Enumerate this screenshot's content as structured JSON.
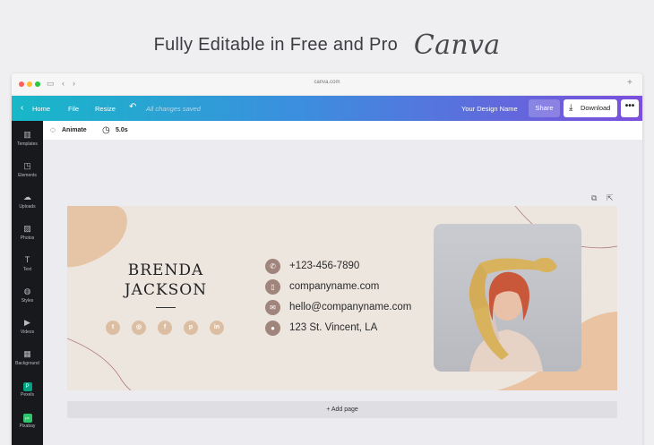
{
  "promo": {
    "title": "Fully Editable in Free and Pro",
    "brand": "Canva"
  },
  "browser": {
    "url": "canva.com",
    "new_tab_icon": "plus-icon"
  },
  "topbar": {
    "home_label": "Home",
    "file_label": "File",
    "resize_label": "Resize",
    "status": "All changes saved",
    "design_name": "Your Design Name",
    "share_label": "Share",
    "download_label": "Download",
    "more_label": "•••"
  },
  "toolbar": {
    "animate_label": "Animate",
    "duration": "5.0s"
  },
  "sidebar": {
    "items": [
      {
        "label": "Templates",
        "icon": "templates-icon"
      },
      {
        "label": "Elements",
        "icon": "elements-icon"
      },
      {
        "label": "Uploads",
        "icon": "uploads-icon"
      },
      {
        "label": "Photos",
        "icon": "photos-icon"
      },
      {
        "label": "Text",
        "icon": "text-icon"
      },
      {
        "label": "Styles",
        "icon": "styles-icon"
      },
      {
        "label": "Videos",
        "icon": "videos-icon"
      },
      {
        "label": "Background",
        "icon": "background-icon"
      },
      {
        "label": "Pexels",
        "icon": "pexels-icon"
      },
      {
        "label": "Pixabay",
        "icon": "pixabay-icon"
      }
    ]
  },
  "card": {
    "first_name": "BRENDA",
    "last_name": "JACKSON",
    "social_icons": [
      "twitter-icon",
      "instagram-icon",
      "facebook-icon",
      "pinterest-icon",
      "linkedin-icon"
    ],
    "phone": "+123-456-7890",
    "website": "companyname.com",
    "email": "hello@companyname.com",
    "address": "123 St. Vincent, LA"
  },
  "canvas": {
    "add_page_label": "+ Add page"
  },
  "colors": {
    "gradient_start": "#17b8c8",
    "gradient_end": "#7b4fdc",
    "card_bg": "#ede6df",
    "accent_peach": "#e8c3a0",
    "icon_brown": "#a0857d"
  }
}
